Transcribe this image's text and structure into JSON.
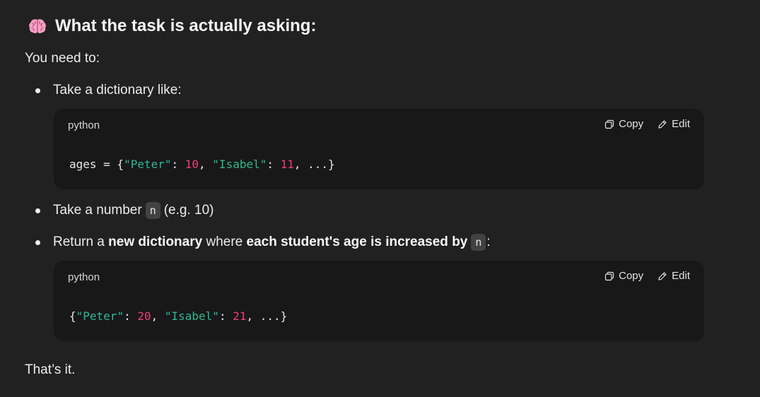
{
  "heading": {
    "icon": "brain-icon",
    "text": "What the task is actually asking:"
  },
  "intro": "You need to:",
  "bullets": {
    "b1": "Take a dictionary like:",
    "b2_pre": "Take a number",
    "b2_code": "n",
    "b2_post": "(e.g. 10)",
    "b3_pre": "Return a",
    "b3_bold1": "new dictionary",
    "b3_mid": "where",
    "b3_bold2": "each student's age is increased by",
    "b3_code": "n",
    "b3_post": ":"
  },
  "code_blocks": [
    {
      "language": "python",
      "copy_label": "Copy",
      "edit_label": "Edit",
      "tokens": [
        {
          "t": "ages = {",
          "k": "plain"
        },
        {
          "t": "\"Peter\"",
          "k": "str"
        },
        {
          "t": ": ",
          "k": "plain"
        },
        {
          "t": "10",
          "k": "num"
        },
        {
          "t": ", ",
          "k": "plain"
        },
        {
          "t": "\"Isabel\"",
          "k": "str"
        },
        {
          "t": ": ",
          "k": "plain"
        },
        {
          "t": "11",
          "k": "num"
        },
        {
          "t": ", ...}",
          "k": "plain"
        }
      ]
    },
    {
      "language": "python",
      "copy_label": "Copy",
      "edit_label": "Edit",
      "tokens": [
        {
          "t": "{",
          "k": "plain"
        },
        {
          "t": "\"Peter\"",
          "k": "str"
        },
        {
          "t": ": ",
          "k": "plain"
        },
        {
          "t": "20",
          "k": "num"
        },
        {
          "t": ", ",
          "k": "plain"
        },
        {
          "t": "\"Isabel\"",
          "k": "str"
        },
        {
          "t": ": ",
          "k": "plain"
        },
        {
          "t": "21",
          "k": "num"
        },
        {
          "t": ", ...}",
          "k": "plain"
        }
      ]
    }
  ],
  "outro": "That’s it.",
  "colors": {
    "background": "#212121",
    "code_background": "#181818",
    "string": "#2fb98f",
    "number": "#ef3e78",
    "brain": "#f4a1c6"
  }
}
